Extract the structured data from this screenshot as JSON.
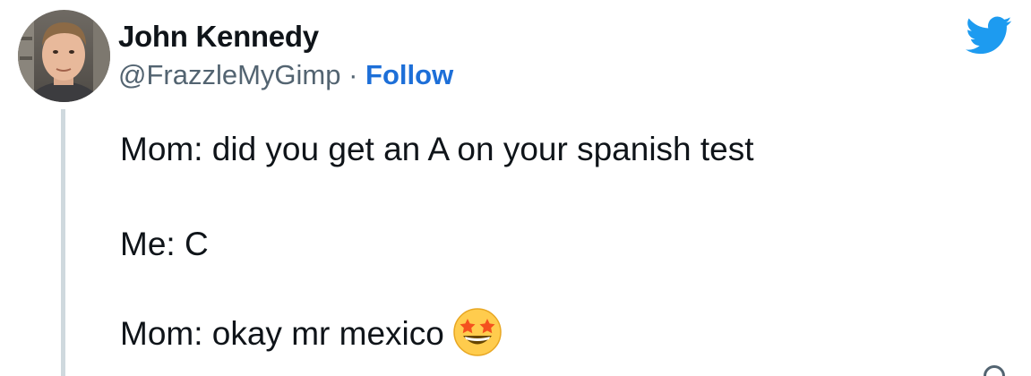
{
  "author": {
    "name": "John Kennedy",
    "handle": "@FrazzleMyGimp",
    "separator": " · ",
    "follow_label": "Follow"
  },
  "tweet": {
    "line1": "Mom: did you get an A on your spanish test",
    "line2": "Me: C",
    "line3": "Mom: okay mr mexico"
  },
  "icons": {
    "brand": "twitter-bird-icon",
    "emoji": "star-struck-emoji"
  },
  "colors": {
    "brand_blue": "#1d9bf0",
    "follow_blue": "#1d6fd8",
    "text": "#0f1419",
    "secondary_text": "#536471"
  }
}
